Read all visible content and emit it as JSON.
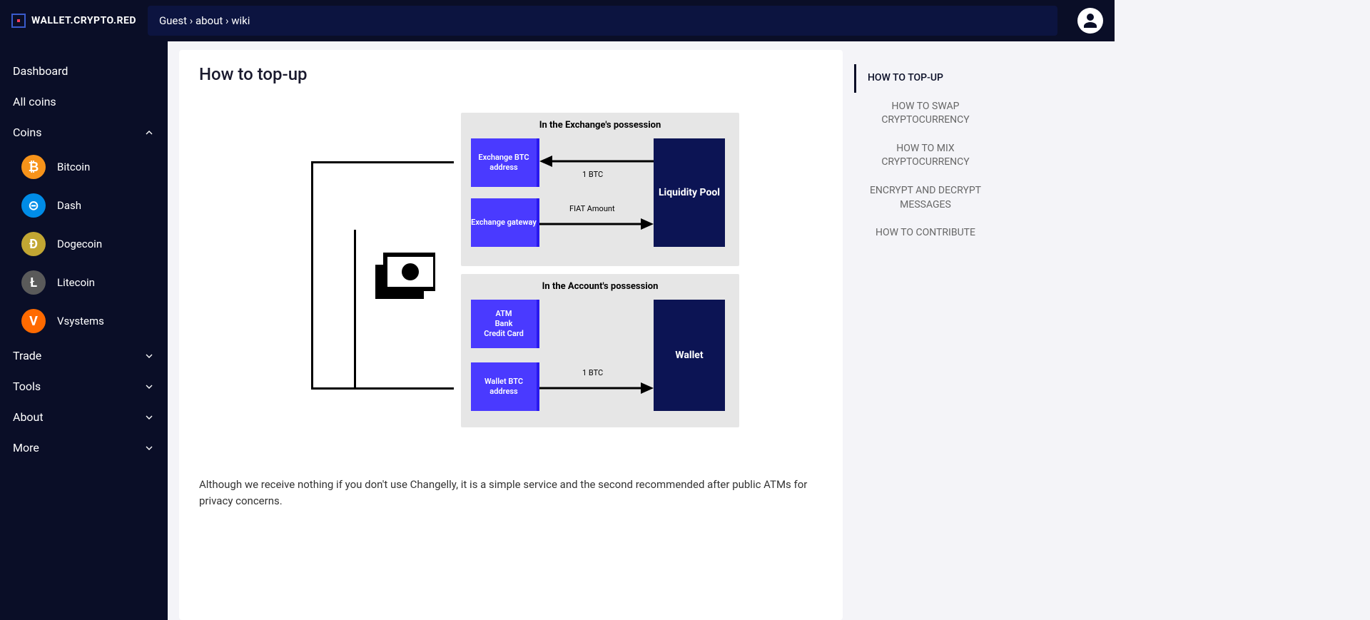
{
  "header": {
    "logo": "WALLET.CRYPTO.RED",
    "breadcrumb": "Guest › about › wiki"
  },
  "sidebar": {
    "dashboard": "Dashboard",
    "all_coins": "All coins",
    "coins": "Coins",
    "coin_list": [
      {
        "name": "Bitcoin",
        "symbol": "₿",
        "bg": "#f7931a"
      },
      {
        "name": "Dash",
        "symbol": "⊝",
        "bg": "#008ce7"
      },
      {
        "name": "Dogecoin",
        "symbol": "Ð",
        "bg": "#c2a633"
      },
      {
        "name": "Litecoin",
        "symbol": "Ł",
        "bg": "#5a5a5a"
      },
      {
        "name": "Vsystems",
        "symbol": "V",
        "bg": "#ff6a00"
      }
    ],
    "trade": "Trade",
    "tools": "Tools",
    "about": "About",
    "more": "More"
  },
  "article": {
    "title": "How to top-up",
    "body": "Although we receive nothing if you don't use Changelly, it is a simple service and the second recommended after public ATMs for privacy concerns."
  },
  "diagram": {
    "group1_title": "In the Exchange's possession",
    "exchange_btc": "Exchange BTC address",
    "exchange_gateway": "Exchange gateway",
    "liquidity_pool": "Liquidity Pool",
    "arrow1_label": "1 BTC",
    "arrow2_label": "FIAT Amount",
    "group2_title": "In the Account's possession",
    "atm_bank": "ATM\nBank\nCredit Card",
    "wallet_btc": "Wallet BTC address",
    "wallet": "Wallet",
    "arrow3_label": "1 BTC"
  },
  "toc": [
    "HOW TO TOP-UP",
    "HOW TO SWAP CRYPTOCURRENCY",
    "HOW TO MIX CRYPTOCURRENCY",
    "ENCRYPT AND DECRYPT MESSAGES",
    "HOW TO CONTRIBUTE"
  ]
}
